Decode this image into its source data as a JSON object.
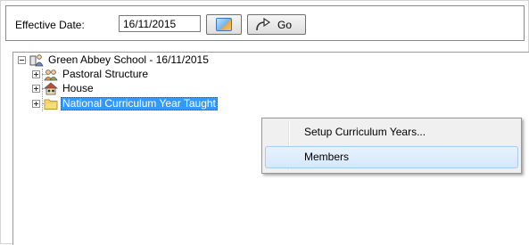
{
  "toolbar": {
    "effective_date_label": "Effective Date:",
    "effective_date_value": "16/11/2015",
    "calendar_icon": "calendar-icon",
    "go_icon": "go-arrow-icon",
    "go_label": "Go"
  },
  "tree": {
    "root": {
      "label": "Green Abbey School - 16/11/2015",
      "icon": "school-icon",
      "expanded": true
    },
    "children": [
      {
        "label": "Pastoral Structure",
        "icon": "pastoral-structure-icon",
        "expanded": false,
        "selected": false
      },
      {
        "label": "House",
        "icon": "house-icon",
        "expanded": false,
        "selected": false
      },
      {
        "label": "National Curriculum Year Taught",
        "icon": "folder-icon",
        "expanded": false,
        "selected": true
      }
    ]
  },
  "context_menu": {
    "items": [
      {
        "label": "Setup Curriculum Years...",
        "highlighted": false
      },
      {
        "label": "Members",
        "highlighted": true
      }
    ]
  },
  "colors": {
    "selection": "#3399ff",
    "menu_background": "#f0f0f0",
    "menu_hover": "#d7e8fb"
  }
}
